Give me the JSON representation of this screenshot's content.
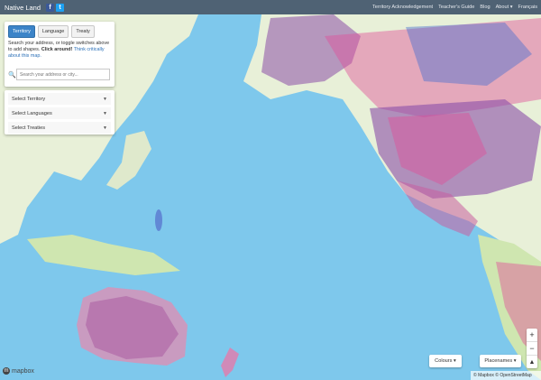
{
  "topbar": {
    "brand": "Native Land",
    "facebook_icon": "f",
    "twitter_icon": "t",
    "nav": [
      "Territory Acknowledgement",
      "Teacher's Guide",
      "Blog",
      "About ▾",
      "Français"
    ]
  },
  "panel": {
    "tabs": [
      "Territory",
      "Language",
      "Treaty"
    ],
    "active_tab": "Territory",
    "help_text": "Search your address, or toggle switches above to add shapes. ",
    "help_bold": "Click around!",
    "help_link": "Think critically about this map.",
    "search_placeholder": "Search your address or city..."
  },
  "selects": [
    "Select Territory",
    "Select Languages",
    "Select Treaties"
  ],
  "controls": {
    "colours": "Colours ▾",
    "placenames": "Placenames ▾",
    "zoom_in": "+",
    "zoom_out": "−",
    "compass": "▲"
  },
  "map": {
    "logo": "mapbox",
    "attribution": "© Mapbox © OpenStreetMap",
    "colors": {
      "ocean": "#7ec8ec",
      "land": "#e8f0d8",
      "land_green": "#cfe6b0",
      "territory_purple": "#8a4fa8",
      "territory_pink": "#e0509a",
      "territory_blue": "#4a6fd0"
    }
  }
}
